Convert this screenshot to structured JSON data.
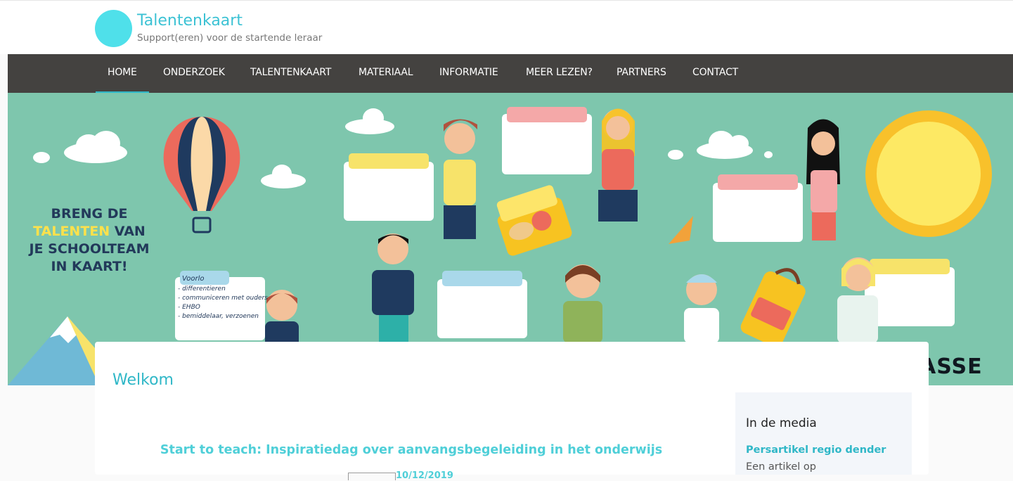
{
  "header": {
    "site_title": "Talentenkaart",
    "tagline": "Support(eren) voor de startende leraar"
  },
  "nav": {
    "items": [
      {
        "label": "HOME",
        "active": true
      },
      {
        "label": "ONDERZOEK"
      },
      {
        "label": "TALENTENKAART"
      },
      {
        "label": "MATERIAAL"
      },
      {
        "label": "INFORMATIE"
      },
      {
        "label": "MEER LEZEN?"
      },
      {
        "label": "PARTNERS"
      },
      {
        "label": "CONTACT"
      }
    ]
  },
  "hero": {
    "slogan_line1": "BRENG DE",
    "slogan_highlight": "TALENTEN",
    "slogan_line2_rest": " VAN",
    "slogan_line3": "JE SCHOOLTEAM",
    "slogan_line4": "IN KAART!",
    "note_title": "Voorlo",
    "note_items": [
      "- differentieren",
      "- communiceren met ouders",
      "- EHBO",
      "- bemiddelaar, verzoenen"
    ],
    "brand_fragment": "ASSE"
  },
  "main": {
    "heading": "Welkom",
    "post_title": "Start to teach: Inspiratiedag over aanvangsbegeleiding in het onderwijs",
    "post_date": "10/12/2019"
  },
  "sidebar": {
    "heading": "In de media",
    "link": "Persartikel regio dender",
    "text": "Een artikel op"
  },
  "colors": {
    "accent": "#2fb7c7",
    "nav_bg": "#444240",
    "hero_bg": "#7ec6ad",
    "logo": "#4fe0ea"
  }
}
